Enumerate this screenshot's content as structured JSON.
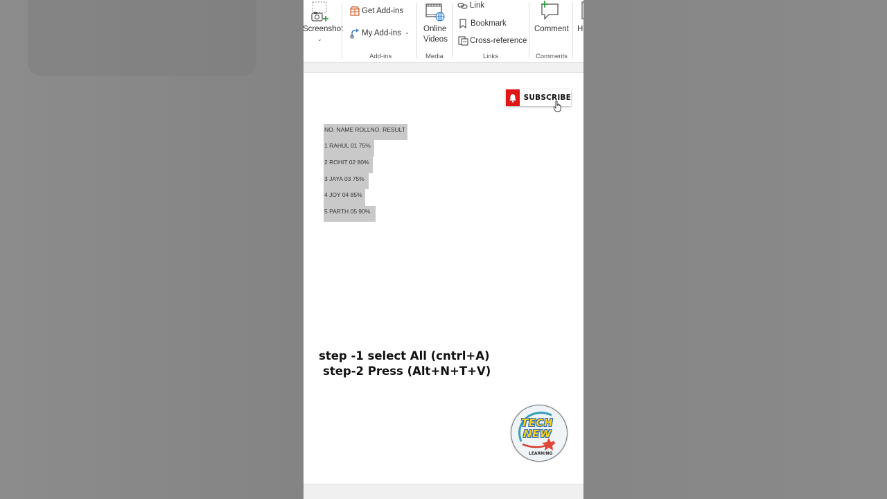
{
  "ribbon": {
    "screenshot_label": "Screenshot",
    "get_addins_label": "Get Add-ins",
    "my_addins_label": "My Add-ins",
    "online_videos_line1": "Online",
    "online_videos_line2": "Videos",
    "link_label": "Link",
    "bookmark_label": "Bookmark",
    "cross_reference_label": "Cross-reference",
    "comment_label": "Comment",
    "header_partial": "H",
    "groups": {
      "addins": "Add-ins",
      "media": "Media",
      "links": "Links",
      "comments": "Comments"
    }
  },
  "overlay": {
    "subscribe_label": "SUBSCRIBE"
  },
  "document": {
    "lines": [
      "NO. NAME ROLLNO. RESULT",
      "1 RAHUL 01 75%",
      "2 ROHIT 02 80%",
      "3 JAYA 03 75%",
      "4 JOY 04 85%",
      "5 PARTH 05 90%"
    ]
  },
  "caption": {
    "step1": "step -1 select All (cntrl+A)",
    "step2": "step-2 Press (Alt+N+T+V)"
  },
  "logo": {
    "text_top": "TECH",
    "text_mid": "NEW",
    "text_bottom": "LEARNING"
  },
  "colors": {
    "subscribe_red": "#e01515",
    "selection_gray": "#c9c9c9",
    "logo_yellow": "#f2d21b",
    "logo_blue": "#2a66c6"
  }
}
